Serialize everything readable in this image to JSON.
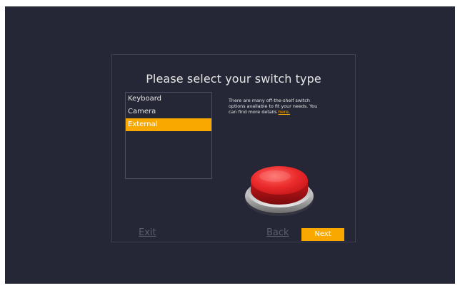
{
  "dialog": {
    "title": "Please select your switch type"
  },
  "switch_list": {
    "items": [
      {
        "label": "Keyboard",
        "selected": false
      },
      {
        "label": "Camera",
        "selected": false
      },
      {
        "label": "External",
        "selected": true
      }
    ]
  },
  "description": {
    "text": "There are many off-the-shelf switch options available to fit your needs. You can find more details ",
    "link_label": "here."
  },
  "footer": {
    "exit_label": "Exit",
    "back_label": "Back",
    "next_label": "Next"
  },
  "illustration": {
    "icon": "red-push-button-icon"
  },
  "colors": {
    "background": "#252737",
    "accent": "#f9a800",
    "text": "#e6e6e6",
    "muted": "#5a5d6e",
    "button_red": "#e8262a"
  }
}
